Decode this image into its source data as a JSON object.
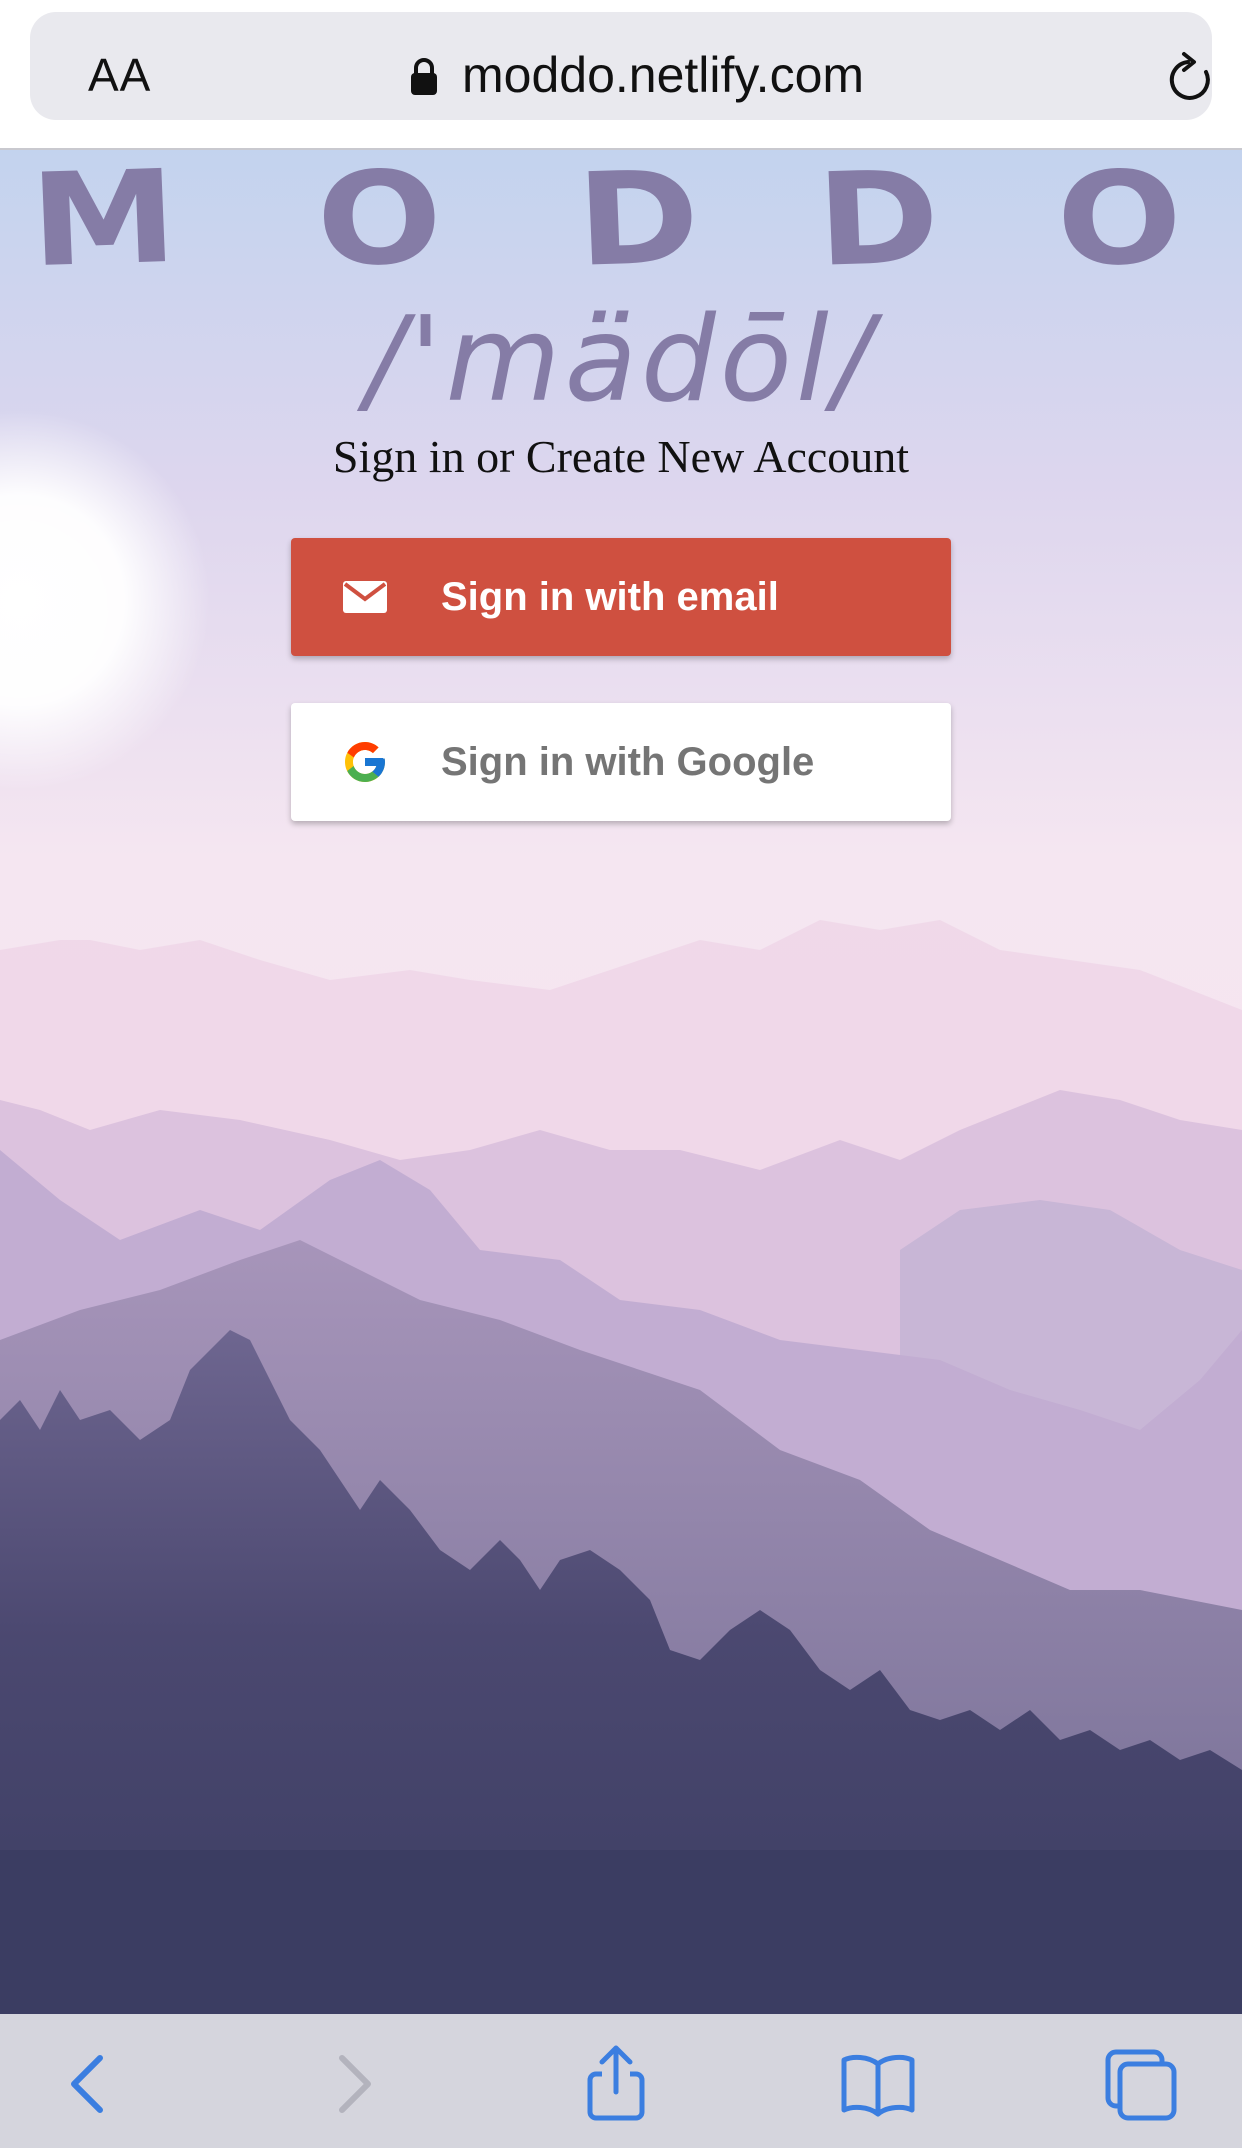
{
  "browser": {
    "text_size_label": "AA",
    "domain": "moddo.netlify.com"
  },
  "logo": {
    "letters": [
      "M",
      "O",
      "D",
      "D",
      "O"
    ],
    "pronunciation": "/'mädōl/"
  },
  "auth": {
    "heading": "Sign in or Create New Account",
    "email_button": "Sign in with email",
    "google_button": "Sign in with Google"
  },
  "colors": {
    "logo": "#857ca6",
    "email_button": "#cf5040",
    "google_button": "#ffffff",
    "toolbar_icon": "#3b7ee0"
  },
  "icons": {
    "lock": "lock-icon",
    "reload": "reload-icon",
    "email": "envelope-icon",
    "google": "google-g-icon",
    "back": "chevron-left-icon",
    "forward": "chevron-right-icon",
    "share": "share-icon",
    "bookmarks": "book-icon",
    "tabs": "tabs-icon"
  }
}
